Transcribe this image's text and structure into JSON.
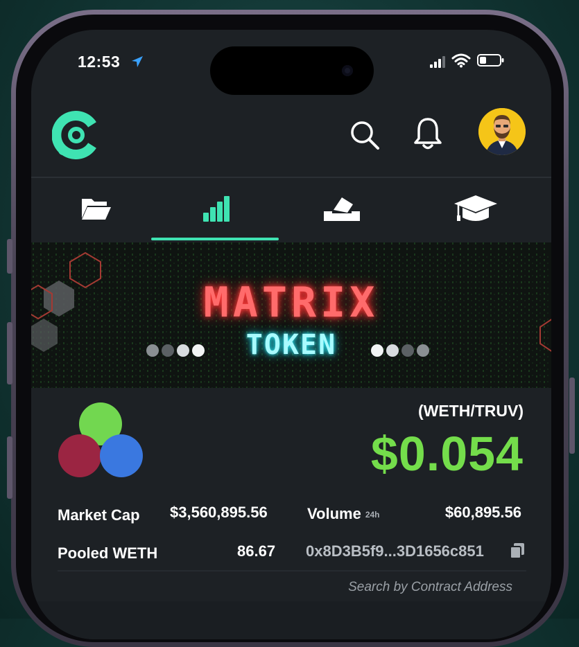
{
  "status_bar": {
    "time": "12:53"
  },
  "banner": {
    "title": "MATRIX",
    "subtitle": "TOKEN"
  },
  "token": {
    "pair": "(WETH/TRUV)",
    "price": "$0.054"
  },
  "stats": {
    "market_cap_label": "Market Cap",
    "market_cap_value": "$3,560,895.56",
    "volume_label": "Volume",
    "volume_period": "24h",
    "volume_value": "$60,895.56",
    "pooled_label": "Pooled WETH",
    "pooled_value": "86.67",
    "contract_address": "0x8D3B5f9...3D1656c851"
  },
  "search": {
    "placeholder": "Search by Contract Address"
  },
  "tabs": [
    {
      "icon": "folder-icon",
      "active": false
    },
    {
      "icon": "bar-chart-icon",
      "active": true
    },
    {
      "icon": "ballot-box-icon",
      "active": false
    },
    {
      "icon": "graduation-cap-icon",
      "active": false
    }
  ],
  "colors": {
    "accent": "#3fe3b2",
    "price_green": "#74dd4b",
    "banner_red": "#ff6b6b",
    "banner_cyan": "#a8fbff",
    "background": "#1d2125"
  }
}
